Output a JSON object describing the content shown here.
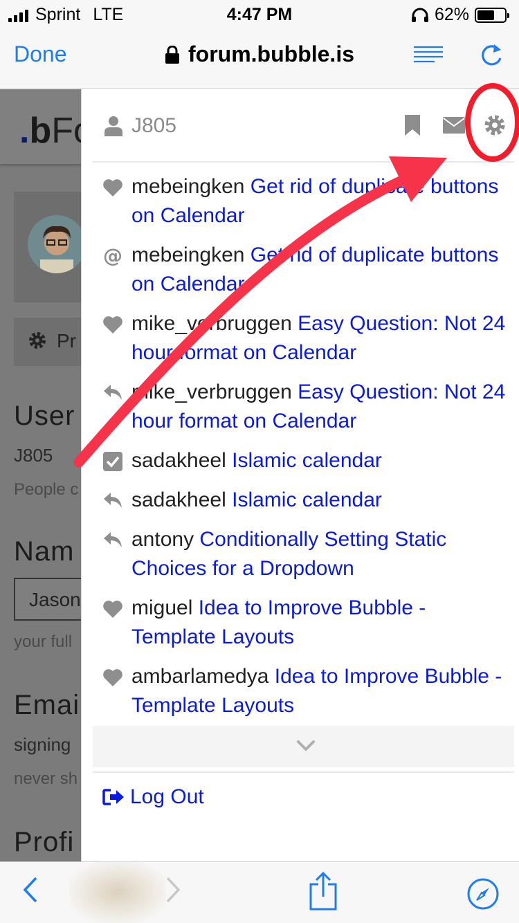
{
  "status_bar": {
    "carrier": "Sprint",
    "network": "LTE",
    "time": "4:47 PM",
    "battery": "62%",
    "battery_level": 0.62
  },
  "browser": {
    "done_label": "Done",
    "url": "forum.bubble.is",
    "reader_icon": "reader-view-icon",
    "reload_icon": "reload-icon"
  },
  "background_page": {
    "logo_text": ".bFo",
    "preferences_tab": "Pr",
    "username_heading": "User",
    "username_value": "J805",
    "username_help": "People c",
    "name_heading": "Nam",
    "name_value": "Jason",
    "name_help": "your full",
    "email_heading": "Emai",
    "email_value": "signing",
    "email_help": "never sh",
    "profile_heading": "Profi"
  },
  "menu": {
    "username": "J805",
    "icons": [
      "user-icon",
      "bookmark-icon",
      "mail-icon",
      "gear-icon"
    ],
    "notifications": [
      {
        "icon": "heart",
        "user": "mebeingken",
        "topic": "Get rid of duplicate buttons on Calendar"
      },
      {
        "icon": "mention",
        "user": "mebeingken",
        "topic": "Get rid of duplicate buttons on Calendar"
      },
      {
        "icon": "heart",
        "user": "mike_verbruggen",
        "topic": "Easy Question: Not 24 hour format on Calendar"
      },
      {
        "icon": "reply",
        "user": "mike_verbruggen",
        "topic": "Easy Question: Not 24 hour format on Calendar"
      },
      {
        "icon": "check",
        "user": "sadakheel",
        "topic": "Islamic calendar"
      },
      {
        "icon": "reply",
        "user": "sadakheel",
        "topic": "Islamic calendar"
      },
      {
        "icon": "reply",
        "user": "antony",
        "topic": "Conditionally Setting Static Choices for a Dropdown"
      },
      {
        "icon": "heart",
        "user": "miguel",
        "topic": "Idea to Improve Bubble - Template Layouts"
      },
      {
        "icon": "heart",
        "user": "ambarlamedya",
        "topic": "Idea to Improve Bubble - Template Layouts"
      }
    ],
    "more_icon": "chevron-down-icon",
    "logout_label": "Log Out"
  },
  "annotation_colors": {
    "arrow": "#f7334a",
    "circle": "#f21c2c"
  },
  "toolbar": {
    "back_icon": "back-icon",
    "forward_icon": "forward-icon",
    "share_icon": "share-icon",
    "compass_icon": "compass-icon"
  },
  "colors": {
    "ios_blue": "#1f7cf2",
    "link_blue": "#0a1ae0",
    "dim_overlay": "#7b7b7b"
  }
}
